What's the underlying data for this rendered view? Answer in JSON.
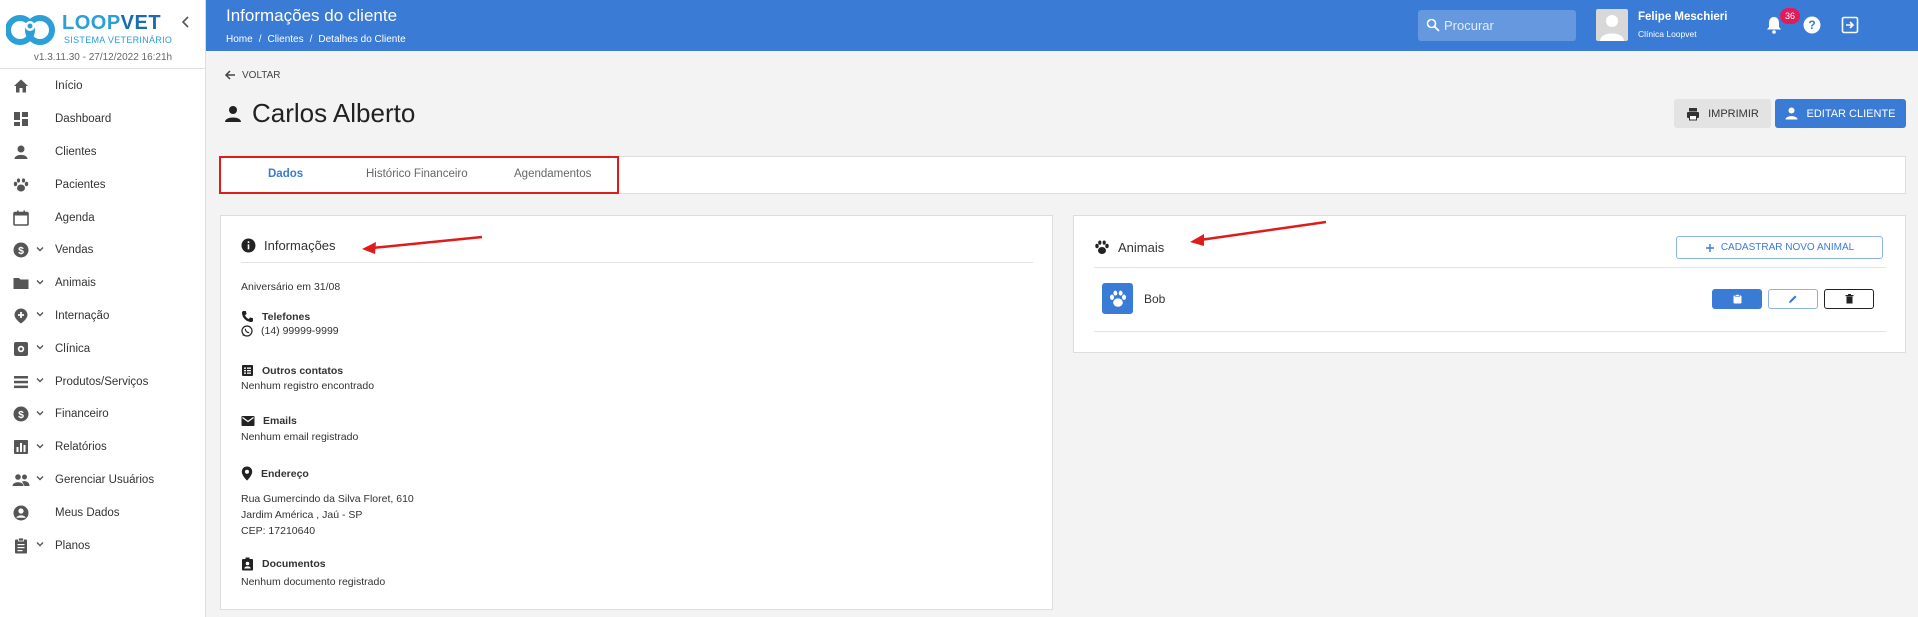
{
  "sidebar": {
    "logo_primary": "LOOP",
    "logo_secondary": "VET",
    "logo_subtitle": "SISTEMA VETERINÁRIO",
    "version": "v1.3.11.30 - 27/12/2022 16:21h",
    "items": [
      {
        "label": "Início",
        "icon": "home-icon",
        "expandable": false
      },
      {
        "label": "Dashboard",
        "icon": "dashboard-icon",
        "expandable": false
      },
      {
        "label": "Clientes",
        "icon": "person-icon",
        "expandable": false
      },
      {
        "label": "Pacientes",
        "icon": "paw-icon",
        "expandable": false
      },
      {
        "label": "Agenda",
        "icon": "calendar-icon",
        "expandable": false
      },
      {
        "label": "Vendas",
        "icon": "dollar-icon",
        "expandable": true
      },
      {
        "label": "Animais",
        "icon": "folder-icon",
        "expandable": true
      },
      {
        "label": "Internação",
        "icon": "hospital-icon",
        "expandable": true
      },
      {
        "label": "Clínica",
        "icon": "clinic-icon",
        "expandable": true
      },
      {
        "label": "Produtos/Serviços",
        "icon": "list-icon",
        "expandable": true
      },
      {
        "label": "Financeiro",
        "icon": "dollar-icon",
        "expandable": true
      },
      {
        "label": "Relatórios",
        "icon": "chart-icon",
        "expandable": true
      },
      {
        "label": "Gerenciar Usuários",
        "icon": "group-icon",
        "expandable": true
      },
      {
        "label": "Meus Dados",
        "icon": "account-icon",
        "expandable": false
      },
      {
        "label": "Planos",
        "icon": "clipboard-icon",
        "expandable": true
      }
    ]
  },
  "header": {
    "title": "Informações do cliente",
    "breadcrumb": [
      "Home",
      "Clientes",
      "Detalhes do Cliente"
    ],
    "breadcrumb_sep": "/",
    "search_placeholder": "Procurar",
    "user_name": "Felipe Meschieri",
    "user_clinic": "Clínica Loopvet",
    "notification_count": "36"
  },
  "page": {
    "back_label": "VOLTAR",
    "client_name": "Carlos Alberto",
    "print_label": "IMPRIMIR",
    "edit_label": "EDITAR CLIENTE",
    "tabs": [
      "Dados",
      "Histórico Financeiro",
      "Agendamentos"
    ],
    "active_tab": 0
  },
  "info": {
    "title": "Informações",
    "birthday": "Aniversário em 31/08",
    "phones_label": "Telefones",
    "phone": "(14) 99999-9999",
    "other_contacts_label": "Outros contatos",
    "other_contacts_value": "Nenhum registro encontrado",
    "emails_label": "Emails",
    "emails_value": "Nenhum email registrado",
    "address_label": "Endereço",
    "address_line1": "Rua Gumercindo da Silva Floret, 610",
    "address_line2": "Jardim América , Jaú - SP",
    "address_line3": "CEP: 17210640",
    "documents_label": "Documentos",
    "documents_value": "Nenhum documento registrado"
  },
  "animals": {
    "title": "Animais",
    "new_button_label": "CADASTRAR NOVO ANIMAL",
    "items": [
      {
        "name": "Bob"
      }
    ]
  },
  "colors": {
    "primary": "#3a7bd5",
    "badge": "#e21b5a",
    "annotation": "#e01b1b"
  }
}
